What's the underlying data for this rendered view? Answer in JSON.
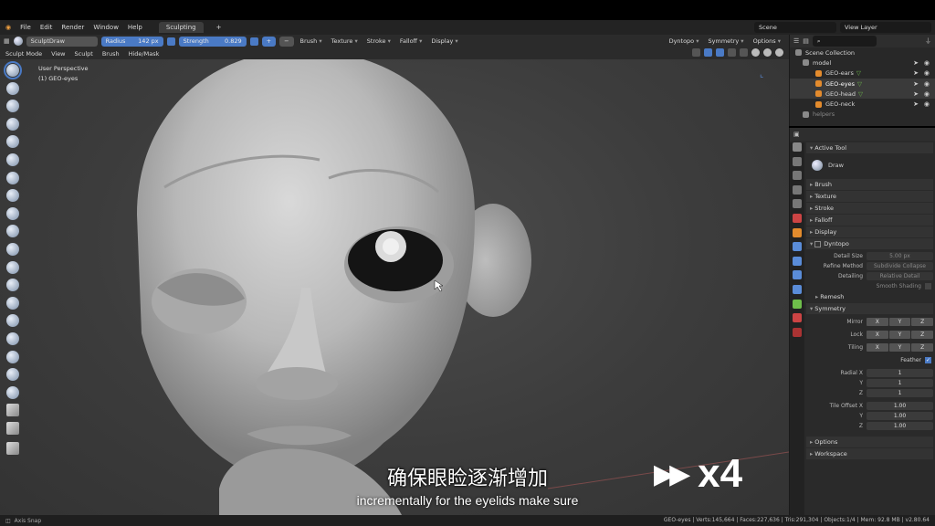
{
  "menu": [
    "File",
    "Edit",
    "Render",
    "Window",
    "Help"
  ],
  "workspace_tab": "Sculpting",
  "scene": {
    "name": "Scene",
    "view_layer": "View Layer"
  },
  "tool_header": {
    "brush_name": "SculptDraw",
    "radius_label": "Radius",
    "radius_value": "142 px",
    "strength_label": "Strength",
    "strength_value": "0.829",
    "dropdowns": [
      "Brush",
      "Texture",
      "Stroke",
      "Falloff",
      "Display"
    ],
    "right": [
      "Dyntopo",
      "Symmetry",
      "Options"
    ]
  },
  "mode_bar": {
    "mode": "Sculpt Mode",
    "items": [
      "View",
      "Sculpt",
      "Brush",
      "Hide/Mask"
    ]
  },
  "viewport": {
    "perspective": "User Perspective",
    "object": "(1) GEO-eyes"
  },
  "subtitle": {
    "chinese": "确保眼睑逐渐增加",
    "english": "incrementally for the eyelids make sure"
  },
  "speed": {
    "arrows": "▶▶",
    "multiplier": "x4"
  },
  "outliner": {
    "root": "Scene Collection",
    "items": [
      {
        "name": "model",
        "indent": 1
      },
      {
        "name": "GEO-ears",
        "indent": 2
      },
      {
        "name": "GEO-eyes",
        "indent": 2,
        "selected": true
      },
      {
        "name": "GEO-head",
        "indent": 2,
        "selected": true
      },
      {
        "name": "GEO-neck",
        "indent": 2
      },
      {
        "name": "helpers",
        "indent": 1
      }
    ]
  },
  "properties": {
    "active_tool_header": "Active Tool",
    "active_tool_name": "Draw",
    "sections": [
      "Brush",
      "Texture",
      "Stroke",
      "Falloff",
      "Display"
    ],
    "dyntopo": {
      "header": "Dyntopo",
      "detail_size_label": "Detail Size",
      "detail_size_value": "5.00 px",
      "refine_method_label": "Refine Method",
      "refine_method_value": "Subdivide Collapse",
      "detailing_label": "Detailing",
      "detailing_value": "Relative Detail",
      "smooth_shading": "Smooth Shading"
    },
    "remesh": "Remesh",
    "symmetry": {
      "header": "Symmetry",
      "mirror": "Mirror",
      "lock": "Lock",
      "tiling": "Tiling",
      "axes": [
        "X",
        "Y",
        "Z"
      ],
      "feather": "Feather",
      "radial_x_label": "Radial X",
      "radial_y_label": "Y",
      "radial_z_label": "Z",
      "radial_x": "1",
      "radial_y": "1",
      "radial_z": "1",
      "tile_offset_x_label": "Tile Offset X",
      "tile_offset_y_label": "Y",
      "tile_offset_z_label": "Z",
      "tile_x": "1.00",
      "tile_y": "1.00",
      "tile_z": "1.00"
    },
    "footer_sections": [
      "Options",
      "Workspace"
    ]
  },
  "status": {
    "left": "Axis Snap",
    "stats": "GEO-eyes | Verts:145,664 | Faces:227,636 | Tris:291,304 | Objects:1/4 | Mem: 92.8 MB | v2.80.64"
  },
  "colors": {
    "accent_blue": "#4a7ac5",
    "object_orange": "#e38b2d",
    "mesh_green": "#6fbf4b"
  }
}
